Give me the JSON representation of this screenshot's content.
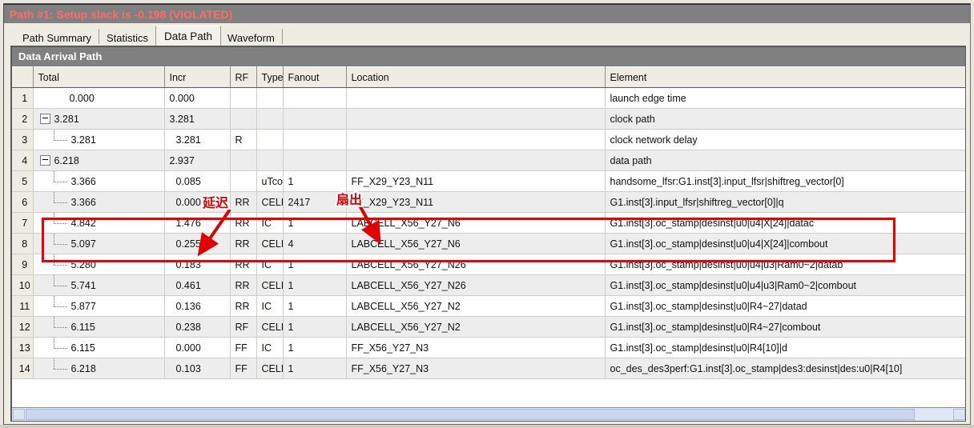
{
  "window": {
    "path_title": "Path #1: Setup slack is -0.198 (VIOLATED)"
  },
  "tabs": [
    {
      "label": "Path Summary",
      "selected": false
    },
    {
      "label": "Statistics",
      "selected": false
    },
    {
      "label": "Data Path",
      "selected": true
    },
    {
      "label": "Waveform",
      "selected": false
    }
  ],
  "section": {
    "title": "Data Arrival Path"
  },
  "table": {
    "columns": [
      "",
      "Total",
      "Incr",
      "RF",
      "Type",
      "Fanout",
      "Location",
      "Element"
    ],
    "rows": [
      {
        "n": "1",
        "total": "0.000",
        "incr": "0.000",
        "rf": "",
        "type": "",
        "fanout": "",
        "location": "",
        "element": "launch edge time",
        "tree": "none"
      },
      {
        "n": "2",
        "total": "3.281",
        "incr": "3.281",
        "rf": "",
        "type": "",
        "fanout": "",
        "location": "",
        "element": "clock path",
        "tree": "expander"
      },
      {
        "n": "3",
        "total": "3.281",
        "incr": "3.281",
        "rf": "R",
        "type": "",
        "fanout": "",
        "location": "",
        "element": "clock network delay",
        "tree": "leaf-last"
      },
      {
        "n": "4",
        "total": "6.218",
        "incr": "2.937",
        "rf": "",
        "type": "",
        "fanout": "",
        "location": "",
        "element": "data path",
        "tree": "expander"
      },
      {
        "n": "5",
        "total": "3.366",
        "incr": "0.085",
        "rf": "",
        "type": "uTco",
        "fanout": "1",
        "location": "FF_X29_Y23_N11",
        "element": "handsome_lfsr:G1.inst[3].input_lfsr|shiftreg_vector[0]",
        "tree": "leaf"
      },
      {
        "n": "6",
        "total": "3.366",
        "incr": "0.000",
        "rf": "RR",
        "type": "CELL",
        "fanout": "2417",
        "location": "FF_X29_Y23_N11",
        "element": "G1.inst[3].input_lfsr|shiftreg_vector[0]|q",
        "tree": "leaf"
      },
      {
        "n": "7",
        "total": "4.842",
        "incr": "1.476",
        "rf": "RR",
        "type": "IC",
        "fanout": "1",
        "location": "LABCELL_X56_Y27_N6",
        "element": "G1.inst[3].oc_stamp|desinst|u0|u4|X[24]|datac",
        "tree": "leaf"
      },
      {
        "n": "8",
        "total": "5.097",
        "incr": "0.255",
        "rf": "RR",
        "type": "CELL",
        "fanout": "4",
        "location": "LABCELL_X56_Y27_N6",
        "element": "G1.inst[3].oc_stamp|desinst|u0|u4|X[24]|combout",
        "tree": "leaf"
      },
      {
        "n": "9",
        "total": "5.280",
        "incr": "0.183",
        "rf": "RR",
        "type": "IC",
        "fanout": "1",
        "location": "LABCELL_X56_Y27_N26",
        "element": "G1.inst[3].oc_stamp|desinst|u0|u4|u3|Ram0~2|datab",
        "tree": "leaf"
      },
      {
        "n": "10",
        "total": "5.741",
        "incr": "0.461",
        "rf": "RR",
        "type": "CELL",
        "fanout": "1",
        "location": "LABCELL_X56_Y27_N26",
        "element": "G1.inst[3].oc_stamp|desinst|u0|u4|u3|Ram0~2|combout",
        "tree": "leaf"
      },
      {
        "n": "11",
        "total": "5.877",
        "incr": "0.136",
        "rf": "RR",
        "type": "IC",
        "fanout": "1",
        "location": "LABCELL_X56_Y27_N2",
        "element": "G1.inst[3].oc_stamp|desinst|u0|R4~27|datad",
        "tree": "leaf"
      },
      {
        "n": "12",
        "total": "6.115",
        "incr": "0.238",
        "rf": "RF",
        "type": "CELL",
        "fanout": "1",
        "location": "LABCELL_X56_Y27_N2",
        "element": "G1.inst[3].oc_stamp|desinst|u0|R4~27|combout",
        "tree": "leaf"
      },
      {
        "n": "13",
        "total": "6.115",
        "incr": "0.000",
        "rf": "FF",
        "type": "IC",
        "fanout": "1",
        "location": "FF_X56_Y27_N3",
        "element": "G1.inst[3].oc_stamp|desinst|u0|R4[10]|d",
        "tree": "leaf"
      },
      {
        "n": "14",
        "total": "6.218",
        "incr": "0.103",
        "rf": "FF",
        "type": "CELL",
        "fanout": "1",
        "location": "FF_X56_Y27_N3",
        "element": "oc_des_des3perf:G1.inst[3].oc_stamp|des3:desinst|des:u0|R4[10]",
        "tree": "leaf-last"
      }
    ]
  },
  "annotations": [
    {
      "id": "delay",
      "text": "延迟"
    },
    {
      "id": "fanout",
      "text": "扇出"
    }
  ],
  "colors": {
    "title_bar": "#808080",
    "title_text": "#ff6b6b",
    "annotation_red": "#e00000",
    "highlight_box": "#ee0000",
    "row_even": "#ededed",
    "row_odd": "#ffffff",
    "header_bg": "#eeece3"
  }
}
